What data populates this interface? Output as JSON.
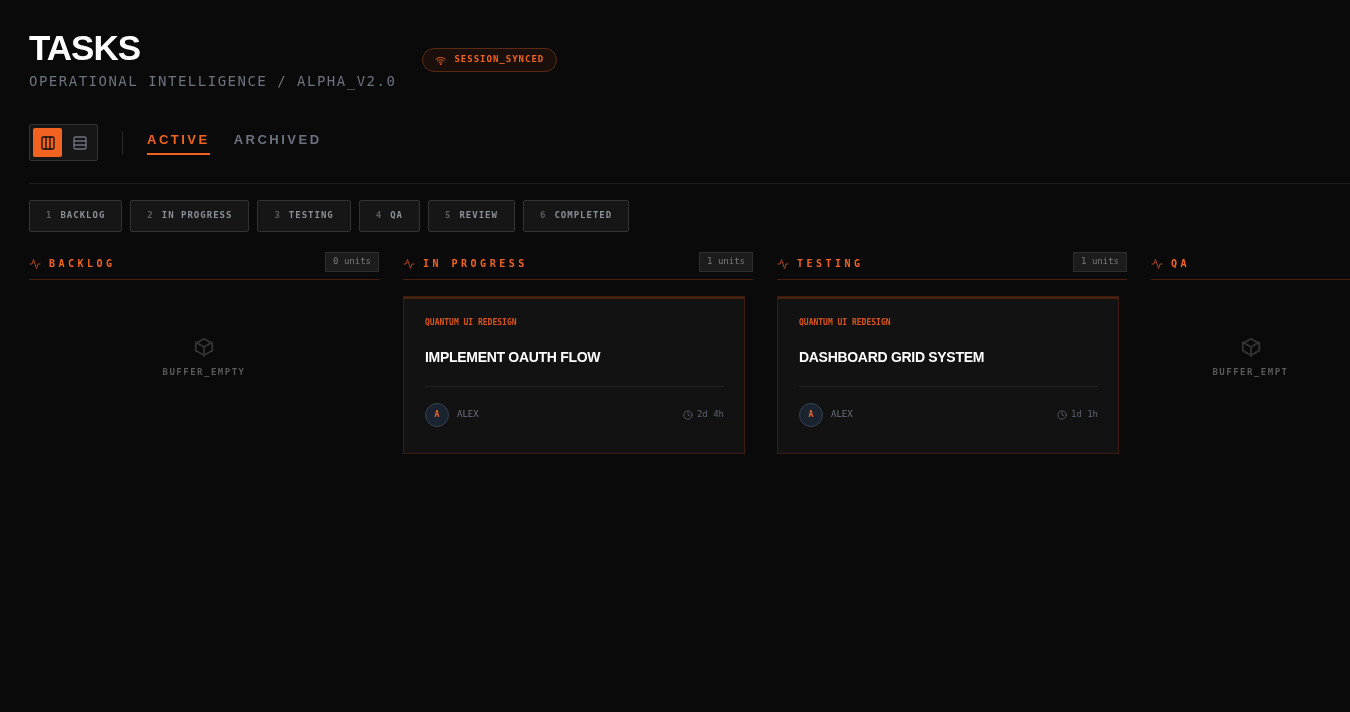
{
  "header": {
    "title": "TASKS",
    "subtitle": "OPERATIONAL INTELLIGENCE / ALPHA_V2.0",
    "status": "SESSION_SYNCED"
  },
  "view_toggle": [
    {
      "kind": "board",
      "selected": true
    },
    {
      "kind": "list",
      "selected": false
    }
  ],
  "tabs": [
    {
      "label": "ACTIVE",
      "selected": true
    },
    {
      "label": "ARCHIVED",
      "selected": false
    }
  ],
  "stage_chips": [
    {
      "number": "1",
      "label": "BACKLOG"
    },
    {
      "number": "2",
      "label": "IN PROGRESS"
    },
    {
      "number": "3",
      "label": "TESTING"
    },
    {
      "number": "4",
      "label": "QA"
    },
    {
      "number": "5",
      "label": "REVIEW"
    },
    {
      "number": "6",
      "label": "COMPLETED"
    }
  ],
  "columns": [
    {
      "title": "BACKLOG",
      "count": "0 units",
      "empty_text": "BUFFER_EMPTY"
    },
    {
      "title": "IN PROGRESS",
      "count": "1 units",
      "cards": [
        {
          "project": "QUANTUM UI REDESIGN",
          "title": "IMPLEMENT OAUTH FLOW",
          "avatar": "A",
          "assignee": "ALEX",
          "time": "2d 4h"
        }
      ]
    },
    {
      "title": "TESTING",
      "count": "1 units",
      "cards": [
        {
          "project": "QUANTUM UI REDESIGN",
          "title": "DASHBOARD GRID SYSTEM",
          "avatar": "A",
          "assignee": "ALEX",
          "time": "1d 1h"
        }
      ]
    },
    {
      "title": "QA",
      "empty_text": "BUFFER_EMPT"
    }
  ]
}
